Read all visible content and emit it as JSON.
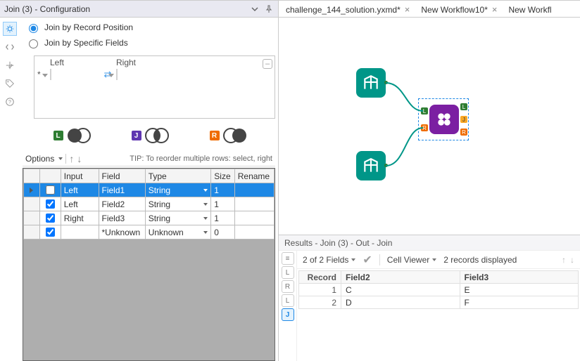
{
  "panel": {
    "title": "Join (3) - Configuration",
    "radio1": "Join by Record Position",
    "radio2": "Join by Specific Fields",
    "selected_radio": 1,
    "fields_header": {
      "left": "Left",
      "right": "Right"
    },
    "options_label": "Options",
    "tip": "TIP: To reorder multiple rows: select, right",
    "grid": {
      "headers": [
        "Input",
        "Field",
        "Type",
        "Size",
        "Rename"
      ],
      "rows": [
        {
          "checked": false,
          "input": "Left",
          "field": "Field1",
          "type": "String",
          "size": "1",
          "selected": true
        },
        {
          "checked": true,
          "input": "Left",
          "field": "Field2",
          "type": "String",
          "size": "1",
          "selected": false
        },
        {
          "checked": true,
          "input": "Right",
          "field": "Field3",
          "type": "String",
          "size": "1",
          "selected": false
        },
        {
          "checked": true,
          "input": "",
          "field": "*Unknown",
          "type": "Unknown",
          "size": "0",
          "selected": false
        }
      ]
    }
  },
  "tabs": [
    {
      "label": "challenge_144_solution.yxmd",
      "dirty": true
    },
    {
      "label": "New Workflow10",
      "dirty": true
    },
    {
      "label": "New Workfl",
      "dirty": false,
      "truncated": true
    }
  ],
  "results": {
    "title": "Results - Join (3) - Out - Join",
    "fields_summary": "2 of 2 Fields",
    "cell_viewer": "Cell Viewer",
    "records_summary": "2 records displayed",
    "columns": [
      "Record",
      "Field2",
      "Field3"
    ],
    "rows": [
      {
        "Record": "1",
        "Field2": "C",
        "Field3": "E"
      },
      {
        "Record": "2",
        "Field2": "D",
        "Field3": "F"
      }
    ],
    "side_buttons": [
      "≡",
      "L",
      "R",
      "L",
      "J"
    ],
    "side_selected": 4
  },
  "anchors": {
    "l": "L",
    "j": "J",
    "r": "R"
  }
}
